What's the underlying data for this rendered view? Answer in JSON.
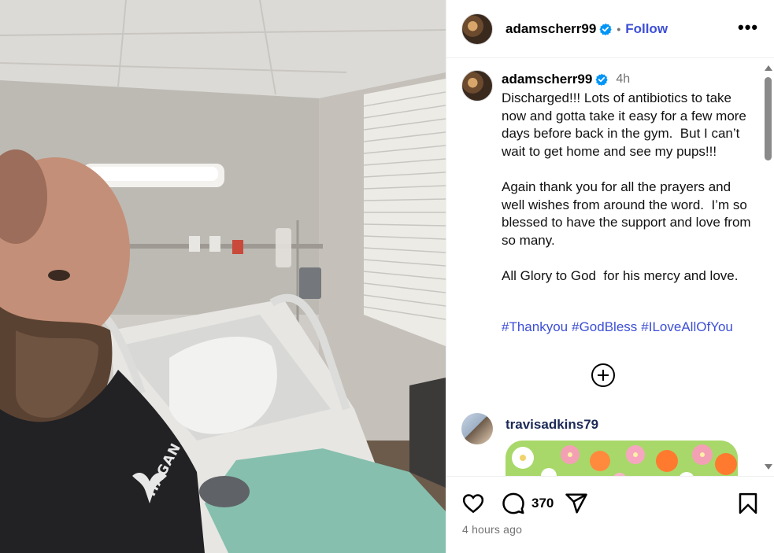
{
  "colors": {
    "accent": "#3d4fd6",
    "verified": "#0095f6",
    "muted": "#737373"
  },
  "header": {
    "username": "adamscherr99",
    "separator": "•",
    "follow_label": "Follow",
    "more_icon": "more-options-icon",
    "more_label": "•••"
  },
  "photo": {
    "shirt_text": "HAGAN"
  },
  "caption": {
    "username": "adamscherr99",
    "time": "4h",
    "text": "Discharged!!! Lots of antibiotics to take now and gotta take it easy for a few more days before back in the gym.  But I can’t wait to get home and see my pups!!!\n\nAgain thank you for all the prayers and well wishes from around the word.  I’m so blessed to have the support and love from so many.\n\nAll Glory to God  for his mercy and love.",
    "hashtags": [
      "#Thankyou",
      "#GodBless",
      "#ILoveAllOfYou"
    ]
  },
  "load_more_icon": "plus-circle-icon",
  "reply": {
    "username": "travisadkins79"
  },
  "actions": {
    "like_icon": "heart-icon",
    "comment_icon": "comment-icon",
    "comment_count": "370",
    "share_icon": "paper-plane-icon",
    "save_icon": "bookmark-icon",
    "timestamp": "4 hours ago"
  }
}
